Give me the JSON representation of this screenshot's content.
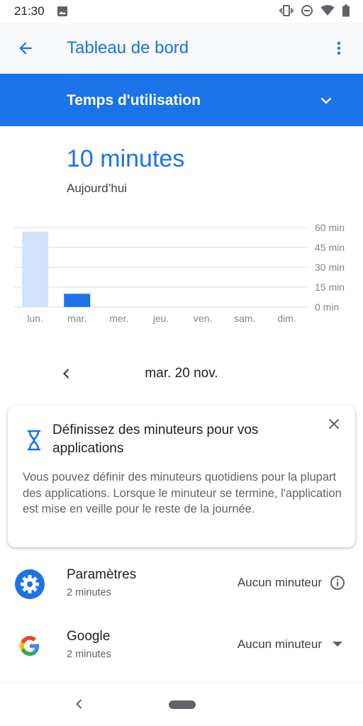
{
  "status_bar": {
    "time": "21:30",
    "icons": [
      "image-icon",
      "vibrate-icon",
      "do-not-disturb-icon",
      "wifi-icon",
      "battery-icon"
    ]
  },
  "app_bar": {
    "title": "Tableau de bord"
  },
  "dropdown": {
    "label": "Temps d'utilisation"
  },
  "summary": {
    "total": "10 minutes",
    "period": "Aujourd’hui"
  },
  "chart_data": {
    "type": "bar",
    "categories": [
      "lun.",
      "mar.",
      "mer.",
      "jeu.",
      "ven.",
      "sam.",
      "dim."
    ],
    "values": [
      57,
      10,
      0,
      0,
      0,
      0,
      0
    ],
    "ylim": [
      0,
      60
    ],
    "yticks": [
      "0 min",
      "15 min",
      "30 min",
      "45 min",
      "60 min"
    ],
    "ytick_values": [
      0,
      15,
      30,
      45,
      60
    ],
    "grid": true,
    "selected_index": 1,
    "colors": {
      "bar": "#d2e3fc",
      "selected_bar": "#1a73e8",
      "grid": "#dadce0",
      "tick_text": "#80868b"
    }
  },
  "date_nav": {
    "label": "mar. 20 nov."
  },
  "tip_card": {
    "title": "Définissez des minuteurs pour vos applications",
    "body": "Vous pouvez définir des minuteurs quotidiens pour la plupart des applications. Lorsque le minuteur se termine, l'application est mise en veille pour le reste de la journée."
  },
  "apps": [
    {
      "name": "Paramètres",
      "time": "2 minutes",
      "timer": "Aucun minuteur",
      "icon": "settings-icon",
      "trailing_icon": "info-icon"
    },
    {
      "name": "Google",
      "time": "2 minutes",
      "timer": "Aucun minuteur",
      "icon": "google-icon",
      "trailing_icon": "dropdown-arrow-icon"
    }
  ],
  "colors": {
    "accent": "#1a73e8",
    "app_bar_bg": "#f8f9fa"
  }
}
